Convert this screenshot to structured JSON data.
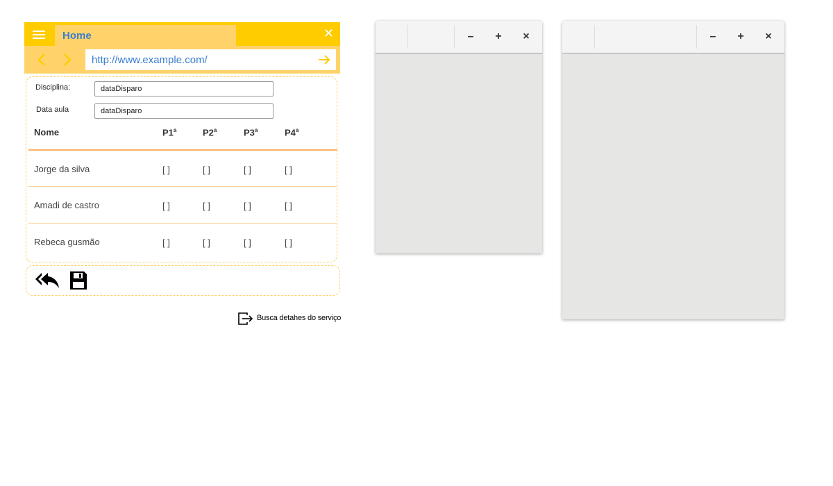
{
  "browser": {
    "tab_title": "Home",
    "url": "http://www.example.com/",
    "menu_icon": "hamburger-icon",
    "close_icon": "close-icon",
    "back_icon": "chevron-left-icon",
    "forward_icon": "chevron-right-icon",
    "go_icon": "arrow-right-icon",
    "accent": "#ffcc00",
    "accent_light": "#ffd36a",
    "link_color": "#3b7ed0"
  },
  "form": {
    "disciplina_label": "Disciplina:",
    "disciplina_value": "dataDisparo",
    "data_aula_label": "Data aula",
    "data_aula_value": "dataDisparo"
  },
  "table": {
    "columns": [
      "Nome",
      "P1",
      "P2",
      "P3",
      "P4"
    ],
    "ordinal": "a",
    "rows": [
      {
        "name": "Jorge da silva",
        "checks": [
          "[ ]",
          "[ ]",
          "[ ]",
          "[ ]"
        ]
      },
      {
        "name": "Amadi de castro",
        "checks": [
          "[ ]",
          "[ ]",
          "[ ]",
          "[ ]"
        ]
      },
      {
        "name": "Rebeca gusmão",
        "checks": [
          "[ ]",
          "[ ]",
          "[ ]",
          "[ ]"
        ]
      }
    ]
  },
  "actions": {
    "reply_all_icon": "reply-all-icon",
    "save_icon": "floppy-disk-icon"
  },
  "service_link": {
    "label": "Busca detahes do serviço",
    "icon": "exit-icon"
  },
  "windows": {
    "minimize": "–",
    "maximize": "+",
    "close": "×"
  }
}
